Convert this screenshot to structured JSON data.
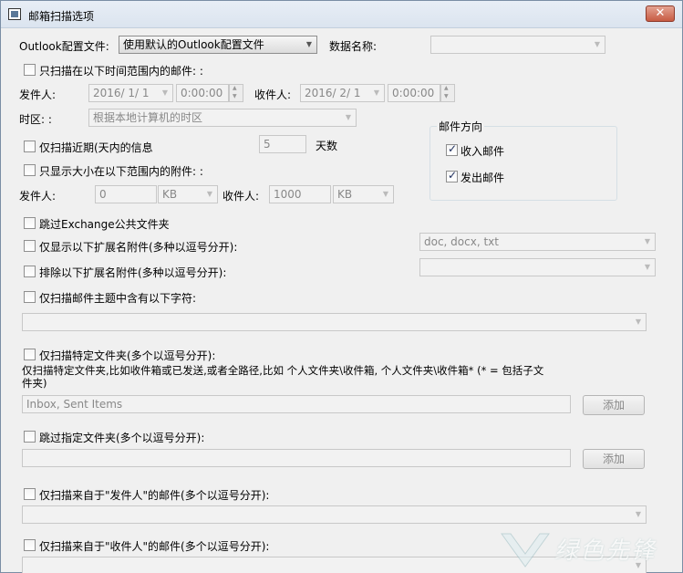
{
  "window": {
    "title": "邮箱扫描选项",
    "close_label": "✕"
  },
  "profile": {
    "label": "Outlook配置文件:",
    "selected": "使用默认的Outlook配置文件",
    "store_label": "数据名称:",
    "store_value": ""
  },
  "date_range": {
    "checkbox_label": "只扫描在以下时间范围内的邮件: :",
    "from_label": "发件人:",
    "from_date": "2016/ 1/ 1",
    "from_time": "0:00:00",
    "to_label": "收件人:",
    "to_date": "2016/ 2/ 1",
    "to_time": "0:00:00",
    "timezone_label": "时区: :",
    "timezone_value": "根据本地计算机的时区"
  },
  "direction": {
    "title": "邮件方向",
    "incoming_label": "收入邮件",
    "incoming_checked": true,
    "outgoing_label": "发出邮件",
    "outgoing_checked": true
  },
  "recent": {
    "checkbox_label": "仅扫描近期(天内的信息",
    "days_value": "5",
    "days_unit": "天数"
  },
  "attachment_size": {
    "checkbox_label": "只显示大小在以下范围内的附件: :",
    "from_label": "发件人:",
    "from_value": "0",
    "from_unit": "KB",
    "to_label": "收件人:",
    "to_value": "1000",
    "to_unit": "KB"
  },
  "skip_exchange": {
    "checkbox_label": "跳过Exchange公共文件夹"
  },
  "ext_include": {
    "checkbox_label": "仅显示以下扩展名附件(多种以逗号分开):",
    "value": "doc, docx, txt"
  },
  "ext_exclude": {
    "checkbox_label": "排除以下扩展名附件(多种以逗号分开):",
    "value": ""
  },
  "subject": {
    "checkbox_label": "仅扫描邮件主题中含有以下字符:",
    "value": ""
  },
  "folders": {
    "checkbox_label": "仅扫描特定文件夹(多个以逗号分开):",
    "hint_line1": "仅扫描特定文件夹,比如收件箱或已发送,或者全路径,比如   个人文件夹\\收件箱, 个人文件夹\\收件箱* (* = 包括子文",
    "hint_line2": "件夹)",
    "value": "Inbox, Sent Items",
    "add_label": "添加"
  },
  "skip_folders": {
    "checkbox_label": "跳过指定文件夹(多个以逗号分开):",
    "value": "",
    "add_label": "添加"
  },
  "from_senders": {
    "checkbox_label": "仅扫描来自于\"发件人\"的邮件(多个以逗号分开):",
    "value": ""
  },
  "to_recipients": {
    "checkbox_label": "仅扫描来自于\"收件人\"的邮件(多个以逗号分开):",
    "value": ""
  },
  "watermark": {
    "text": "绿色先锋"
  }
}
